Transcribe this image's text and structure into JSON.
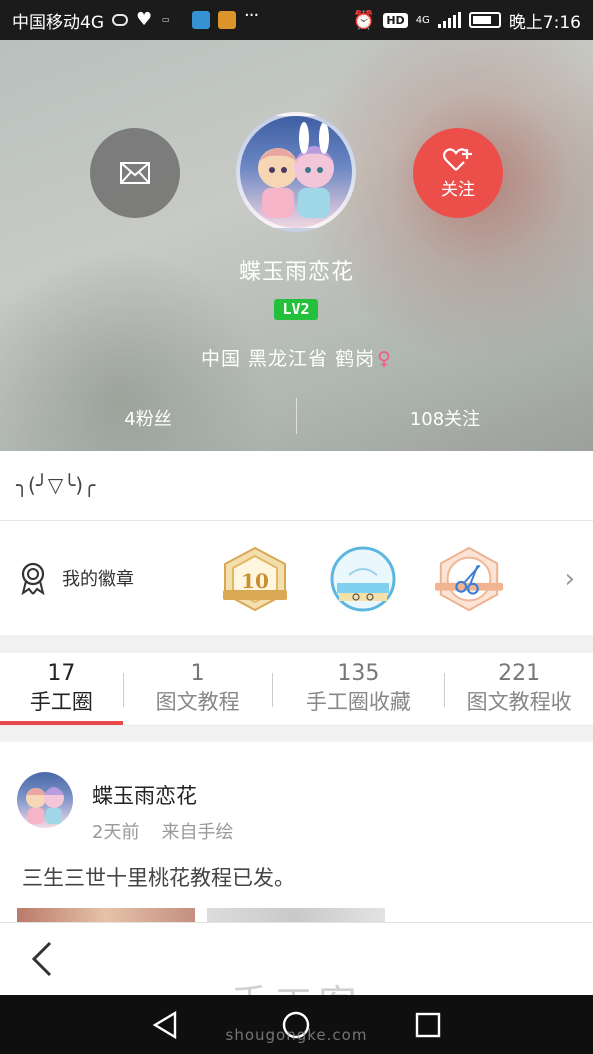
{
  "status_bar": {
    "carrier": "中国移动4G",
    "time": "晚上7:16",
    "network": "4G",
    "hd": "HD",
    "battery_level": 0.75
  },
  "profile": {
    "message_button_icon": "envelope-icon",
    "follow_label": "关注",
    "username": "蝶玉雨恋花",
    "level": "LV2",
    "location": {
      "country": "中国",
      "province": "黑龙江省",
      "city": "鹤岗",
      "gender_symbol": "♀"
    },
    "fans": "4粉丝",
    "following": "108关注"
  },
  "bio": "╮(╯▽╰)╭",
  "badges": {
    "title": "我的徽章",
    "items": [
      {
        "name": "level-10-badge",
        "text": "10",
        "color": "#e9c57f"
      },
      {
        "name": "beach-badge",
        "color": "#74c4e6"
      },
      {
        "name": "scissors-badge",
        "color": "#f1b99e"
      }
    ]
  },
  "tabs": [
    {
      "count": "17",
      "label": "手工圈",
      "active": true
    },
    {
      "count": "1",
      "label": "图文教程",
      "active": false
    },
    {
      "count": "135",
      "label": "手工圈收藏",
      "active": false
    },
    {
      "count": "221",
      "label": "图文教程收",
      "active": false
    }
  ],
  "post": {
    "author": "蝶玉雨恋花",
    "time": "2天前",
    "source": "来自手绘",
    "text": "三生三世十里桃花教程已发。"
  },
  "watermark": {
    "title": "手工客",
    "url": "shougongke.com"
  },
  "colors": {
    "accent": "#e8484a",
    "follow": "#ec4f4a",
    "level": "#25c03b",
    "female": "#ef5c90"
  }
}
